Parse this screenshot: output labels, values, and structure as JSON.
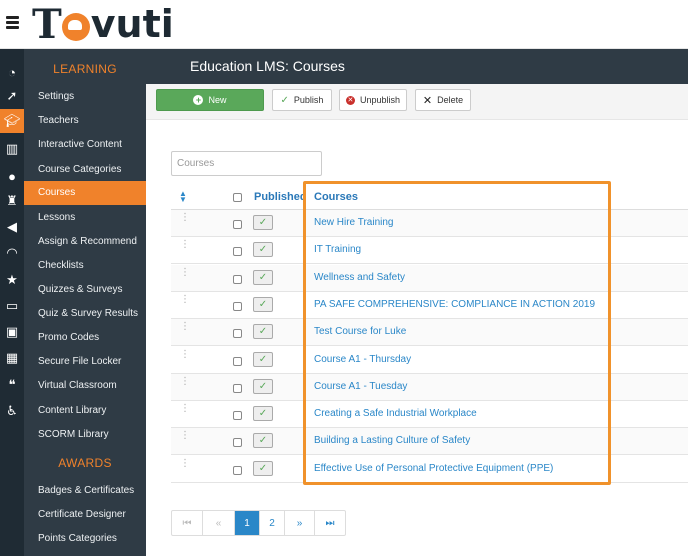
{
  "brand": {
    "name_first": "T",
    "name_rest": "vuti",
    "logo_color": "#f0822b"
  },
  "sidebar": {
    "sections": [
      {
        "heading": "LEARNING",
        "items": [
          {
            "label": "Settings"
          },
          {
            "label": "Teachers"
          },
          {
            "label": "Interactive Content"
          },
          {
            "label": "Course Categories"
          },
          {
            "label": "Courses",
            "active": true
          },
          {
            "label": "Lessons"
          },
          {
            "label": "Assign & Recommend"
          },
          {
            "label": "Checklists"
          },
          {
            "label": "Quizzes & Surveys"
          },
          {
            "label": "Quiz & Survey Results"
          },
          {
            "label": "Promo Codes"
          },
          {
            "label": "Secure File Locker"
          },
          {
            "label": "Virtual Classroom"
          },
          {
            "label": "Content Library"
          },
          {
            "label": "SCORM Library"
          }
        ]
      },
      {
        "heading": "AWARDS",
        "items": [
          {
            "label": "Badges & Certificates"
          },
          {
            "label": "Certificate Designer"
          },
          {
            "label": "Points Categories"
          }
        ]
      }
    ]
  },
  "header": {
    "title": "Education LMS: Courses"
  },
  "toolbar": {
    "new_label": "New",
    "publish_label": "Publish",
    "unpublish_label": "Unpublish",
    "delete_label": "Delete"
  },
  "search": {
    "placeholder": "Courses",
    "value": ""
  },
  "table": {
    "columns": {
      "published": "Published",
      "courses": "Courses"
    },
    "rows": [
      {
        "title": "New Hire Training",
        "published": true
      },
      {
        "title": "IT Training",
        "published": true
      },
      {
        "title": "Wellness and Safety",
        "published": true
      },
      {
        "title": "PA SAFE COMPREHENSIVE: COMPLIANCE IN ACTION 2019",
        "published": true
      },
      {
        "title": "Test Course for Luke",
        "published": true
      },
      {
        "title": "Course A1 - Thursday",
        "published": true
      },
      {
        "title": "Course A1 - Tuesday",
        "published": true
      },
      {
        "title": "Creating a Safe Industrial Workplace",
        "published": true
      },
      {
        "title": "Building a Lasting Culture of Safety",
        "published": true
      },
      {
        "title": "Effective Use of Personal Protective Equipment (PPE)",
        "published": true
      }
    ]
  },
  "pagination": {
    "pages": [
      "1",
      "2"
    ],
    "current": "1"
  },
  "colors": {
    "accent": "#f0822b",
    "sidebar_bg": "#2f3b45",
    "rail_bg": "#1f2b34",
    "link": "#2a87c8",
    "success": "#5aa85a",
    "highlight_border": "#f0922b"
  },
  "rail_icons": [
    "dashboard-icon",
    "rocket-icon",
    "graduation-cap-icon",
    "bar-chart-icon",
    "users-icon",
    "trophy-icon",
    "megaphone-icon",
    "signal-icon",
    "star-icon",
    "credit-card-icon",
    "badge-icon",
    "calendar-icon",
    "chat-icon",
    "accessibility-icon"
  ]
}
